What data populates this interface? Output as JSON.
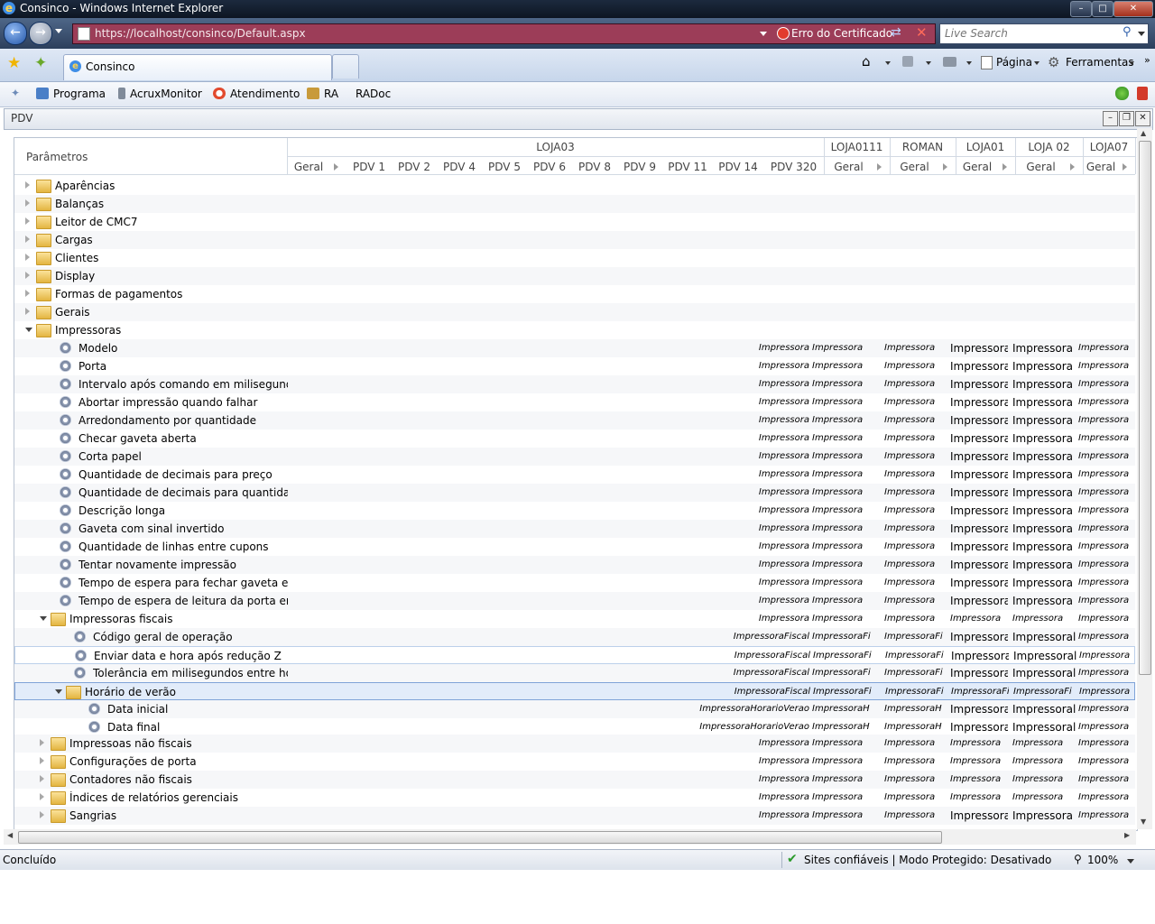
{
  "window": {
    "title": "Consinco - Windows Internet Explorer",
    "url": "https://localhost/consinco/Default.aspx",
    "cert_error": "Erro do Certificado",
    "search_placeholder": "Live Search"
  },
  "tab": {
    "label": "Consinco"
  },
  "commands": {
    "pagina": "Página",
    "ferramentas": "Ferramentas"
  },
  "links": [
    "Programa",
    "AcruxMonitor",
    "Atendimento",
    "RA",
    "RADoc"
  ],
  "pdv": {
    "title": "PDV",
    "param_header": "Parâmetros",
    "groups": [
      "LOJA03",
      "LOJA0111",
      "ROMAN",
      "LOJA01",
      "LOJA 02",
      "LOJA07"
    ],
    "columns": [
      "Geral",
      "PDV 1",
      "PDV 2",
      "PDV 4",
      "PDV 5",
      "PDV 6",
      "PDV 8",
      "PDV 9",
      "PDV 11",
      "PDV 14",
      "PDV 320",
      "Geral",
      "Geral",
      "Geral",
      "Geral",
      "Geral"
    ]
  },
  "tree": [
    {
      "label": "Aparências",
      "level": 0,
      "type": "folder",
      "state": "col",
      "vals": []
    },
    {
      "label": "Balanças",
      "level": 0,
      "type": "folder",
      "state": "col",
      "vals": []
    },
    {
      "label": "Leitor de CMC7",
      "level": 0,
      "type": "folder",
      "state": "col",
      "vals": []
    },
    {
      "label": "Cargas",
      "level": 0,
      "type": "folder",
      "state": "col",
      "vals": []
    },
    {
      "label": "Clientes",
      "level": 0,
      "type": "folder",
      "state": "col",
      "vals": []
    },
    {
      "label": "Display",
      "level": 0,
      "type": "folder",
      "state": "col",
      "vals": []
    },
    {
      "label": "Formas de pagamentos",
      "level": 0,
      "type": "folder",
      "state": "col",
      "vals": []
    },
    {
      "label": "Gerais",
      "level": 0,
      "type": "folder",
      "state": "col",
      "vals": []
    },
    {
      "label": "Impressoras",
      "level": 0,
      "type": "folder",
      "state": "open",
      "vals": []
    },
    {
      "label": "Modelo",
      "level": 1,
      "type": "param",
      "vals": [
        "Impressora",
        "Impressora",
        "Impressora",
        "Impressora",
        "Impressora",
        "Impressora"
      ]
    },
    {
      "label": "Porta",
      "level": 1,
      "type": "param",
      "vals": [
        "Impressora",
        "Impressora",
        "Impressora",
        "Impressora",
        "Impressora",
        "Impressora"
      ]
    },
    {
      "label": "Intervalo após comando em milisegundos",
      "level": 1,
      "type": "param",
      "vals": [
        "Impressora",
        "Impressora",
        "Impressora",
        "Impressora",
        "Impressora",
        "Impressora"
      ]
    },
    {
      "label": "Abortar impressão quando falhar",
      "level": 1,
      "type": "param",
      "vals": [
        "Impressora",
        "Impressora",
        "Impressora",
        "Impressora",
        "Impressora",
        "Impressora"
      ]
    },
    {
      "label": "Arredondamento por quantidade",
      "level": 1,
      "type": "param",
      "vals": [
        "Impressora",
        "Impressora",
        "Impressora",
        "Impressora",
        "Impressora",
        "Impressora"
      ]
    },
    {
      "label": "Checar gaveta aberta",
      "level": 1,
      "type": "param",
      "vals": [
        "Impressora",
        "Impressora",
        "Impressora",
        "Impressora",
        "Impressora",
        "Impressora"
      ]
    },
    {
      "label": "Corta papel",
      "level": 1,
      "type": "param",
      "vals": [
        "Impressora",
        "Impressora",
        "Impressora",
        "Impressora",
        "Impressora",
        "Impressora"
      ]
    },
    {
      "label": "Quantidade de decimais para preço",
      "level": 1,
      "type": "param",
      "vals": [
        "Impressora",
        "Impressora",
        "Impressora",
        "Impressora",
        "Impressora",
        "Impressora"
      ]
    },
    {
      "label": "Quantidade de decimais para quantidade",
      "level": 1,
      "type": "param",
      "vals": [
        "Impressora",
        "Impressora",
        "Impressora",
        "Impressora",
        "Impressora",
        "Impressora"
      ]
    },
    {
      "label": "Descrição longa",
      "level": 1,
      "type": "param",
      "vals": [
        "Impressora",
        "Impressora",
        "Impressora",
        "Impressora",
        "Impressora",
        "Impressora"
      ]
    },
    {
      "label": "Gaveta com sinal invertido",
      "level": 1,
      "type": "param",
      "vals": [
        "Impressora",
        "Impressora",
        "Impressora",
        "Impressora",
        "Impressora",
        "Impressora"
      ]
    },
    {
      "label": "Quantidade de linhas entre cupons",
      "level": 1,
      "type": "param",
      "vals": [
        "Impressora",
        "Impressora",
        "Impressora",
        "Impressora",
        "Impressora",
        "Impressora"
      ]
    },
    {
      "label": "Tentar novamente impressão",
      "level": 1,
      "type": "param",
      "vals": [
        "Impressora",
        "Impressora",
        "Impressora",
        "Impressora",
        "Impressora",
        "Impressora"
      ]
    },
    {
      "label": "Tempo de espera para fechar gaveta em mi",
      "level": 1,
      "type": "param",
      "vals": [
        "Impressora",
        "Impressora",
        "Impressora",
        "Impressora",
        "Impressora",
        "Impressora"
      ]
    },
    {
      "label": "Tempo de espera de leitura da porta em mi",
      "level": 1,
      "type": "param",
      "vals": [
        "Impressora",
        "Impressora",
        "Impressora",
        "Impressora",
        "Impressora",
        "Impressora"
      ]
    },
    {
      "label": "Impressoras fiscais",
      "level": 1,
      "type": "folder",
      "state": "open",
      "vals": [
        "Impressora",
        "Impressora",
        "Impressora",
        "Impressora",
        "Impressora",
        "Impressora"
      ]
    },
    {
      "label": "Código geral de operação",
      "level": 2,
      "type": "param",
      "vals": [
        "ImpressoraFiscal",
        "ImpressoraFi",
        "ImpressoraFi",
        "Impressoral",
        "Impressoral",
        "Impressora"
      ]
    },
    {
      "label": "Enviar data e hora após redução Z",
      "level": 2,
      "type": "param",
      "vals": [
        "ImpressoraFiscal",
        "ImpressoraFi",
        "ImpressoraFi",
        "Impressoral",
        "Impressoral",
        "Impressora"
      ]
    },
    {
      "label": "Tolerância em milisegundos entre horário",
      "level": 2,
      "type": "param",
      "vals": [
        "ImpressoraFiscal",
        "ImpressoraFi",
        "ImpressoraFi",
        "Impressoral",
        "Impressoral",
        "Impressora"
      ]
    },
    {
      "label": "Horário de verão",
      "level": 2,
      "type": "folder",
      "state": "open",
      "vals": [
        "ImpressoraFiscal",
        "ImpressoraFi",
        "ImpressoraFi",
        "ImpressoraFi",
        "ImpressoraFi",
        "Impressora"
      ]
    },
    {
      "label": "Data inicial",
      "level": 3,
      "type": "param",
      "vals": [
        "ImpressoraHorarioVerao",
        "ImpressoraH",
        "ImpressoraH",
        "Impressoral",
        "Impressoral",
        "Impressora"
      ]
    },
    {
      "label": "Data final",
      "level": 3,
      "type": "param",
      "vals": [
        "ImpressoraHorarioVerao",
        "ImpressoraH",
        "ImpressoraH",
        "Impressoral",
        "Impressoral",
        "Impressora"
      ]
    },
    {
      "label": "Impressoas não fiscais",
      "level": 1,
      "type": "folder",
      "state": "col",
      "vals": [
        "Impressora",
        "Impressora",
        "Impressora",
        "Impressora",
        "Impressora",
        "Impressora"
      ]
    },
    {
      "label": "Configurações de porta",
      "level": 1,
      "type": "folder",
      "state": "col",
      "vals": [
        "Impressora",
        "Impressora",
        "Impressora",
        "Impressora",
        "Impressora",
        "Impressora"
      ]
    },
    {
      "label": "Contadores não fiscais",
      "level": 1,
      "type": "folder",
      "state": "col",
      "vals": [
        "Impressora",
        "Impressora",
        "Impressora",
        "Impressora",
        "Impressora",
        "Impressora"
      ]
    },
    {
      "label": "Índices de relatórios gerenciais",
      "level": 1,
      "type": "folder",
      "state": "col",
      "vals": [
        "Impressora",
        "Impressora",
        "Impressora",
        "Impressora",
        "Impressora",
        "Impressora"
      ]
    },
    {
      "label": "Sangrias",
      "level": 1,
      "type": "folder",
      "state": "col",
      "vals": [
        "Impressora",
        "Impressora",
        "Impressora",
        "Impressora",
        "Impressora",
        "Impressora"
      ]
    }
  ],
  "status": {
    "left": "Concluído",
    "zone": "Sites confiáveis | Modo Protegido: Desativado",
    "zoom": "100%"
  }
}
